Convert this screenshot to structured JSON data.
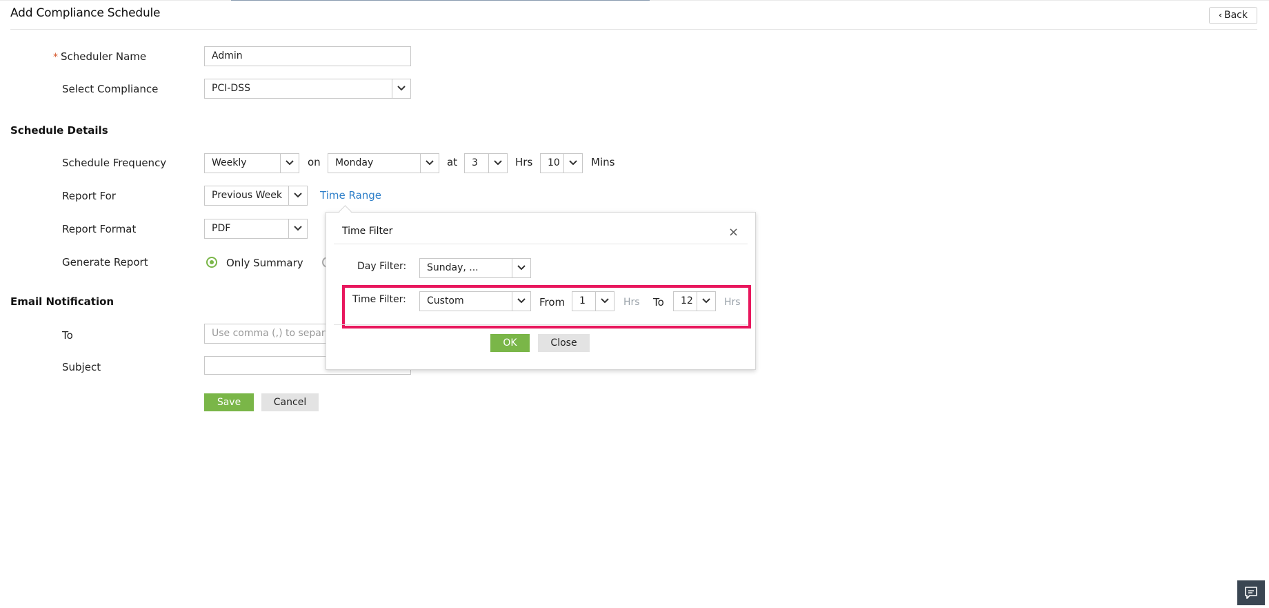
{
  "page": {
    "title": "Add Compliance Schedule",
    "back_label": "Back"
  },
  "form": {
    "scheduler_name": {
      "label": "Scheduler Name",
      "required_mark": "*",
      "value": "Admin"
    },
    "select_compliance": {
      "label": "Select Compliance",
      "value": "PCI-DSS"
    }
  },
  "schedule_details": {
    "heading": "Schedule Details",
    "frequency": {
      "label": "Schedule Frequency",
      "value": "Weekly",
      "on_label": "on",
      "day_value": "Monday",
      "at_label": "at",
      "hour_value": "3",
      "hrs_label": "Hrs",
      "minute_value": "10",
      "mins_label": "Mins"
    },
    "report_for": {
      "label": "Report For",
      "value": "Previous Week",
      "time_range_link": "Time Range"
    },
    "report_format": {
      "label": "Report Format",
      "value": "PDF"
    },
    "generate_report": {
      "label": "Generate Report",
      "option_selected": "Only Summary"
    }
  },
  "email_notification": {
    "heading": "Email Notification",
    "to": {
      "label": "To",
      "placeholder": "Use comma (,) to separ"
    },
    "subject": {
      "label": "Subject",
      "value": ""
    }
  },
  "actions": {
    "save_label": "Save",
    "cancel_label": "Cancel"
  },
  "time_filter_popup": {
    "title": "Time Filter",
    "close_glyph": "×",
    "day_filter": {
      "label": "Day Filter:",
      "value": "Sunday, ..."
    },
    "time_filter": {
      "label": "Time Filter:",
      "value": "Custom",
      "from_label": "From",
      "from_value": "1",
      "from_unit": "Hrs",
      "to_label": "To",
      "to_value": "12",
      "to_unit": "Hrs"
    },
    "ok_label": "OK",
    "close_label": "Close"
  },
  "colors": {
    "accent_green": "#7ab648",
    "link_blue": "#2e7fc9",
    "highlight_pink": "#e8175d",
    "required_orange": "#d6582c",
    "chat_button": "#3a4652"
  },
  "icons": {
    "back": "chevron-left-icon",
    "dropdown": "chevron-down-icon",
    "close": "close-icon",
    "radio": "radio-selected-icon",
    "chat": "chat-icon"
  }
}
